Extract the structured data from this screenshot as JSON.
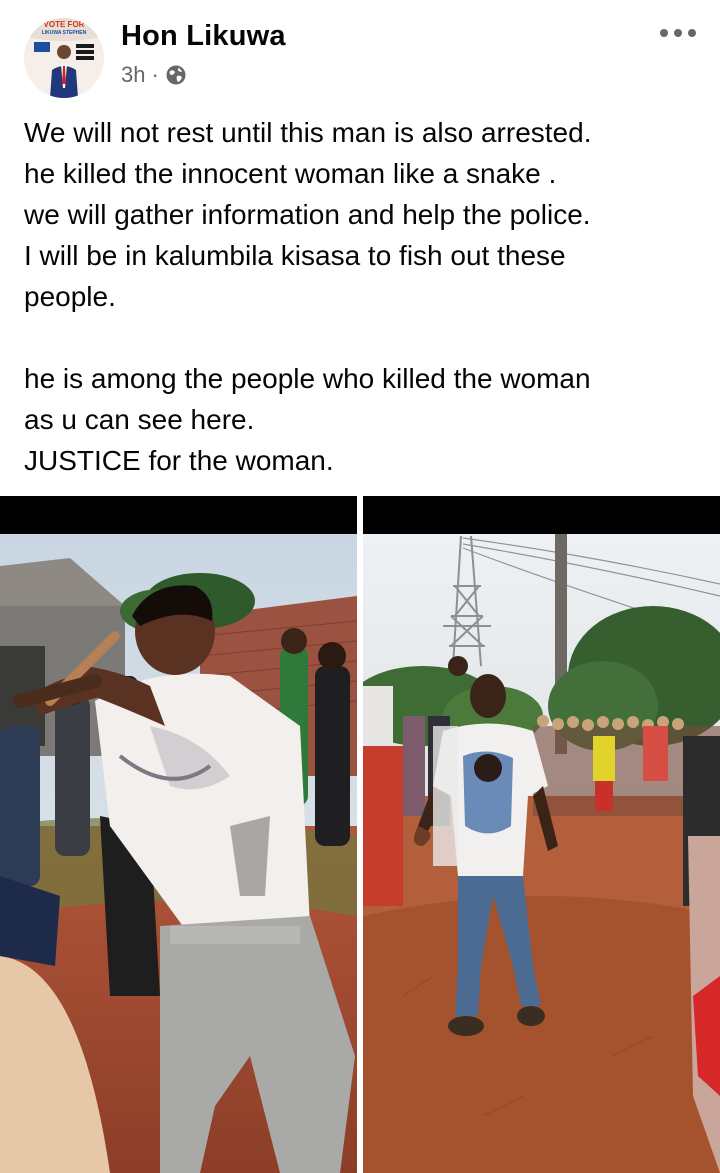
{
  "post": {
    "author": "Hon Likuwa",
    "time": "3h",
    "separator": "·",
    "privacy_icon": "globe-icon",
    "more_icon": "more-options-icon",
    "avatar_text": {
      "top": "VOTE FOR",
      "name": "LIKUWA STEPHEN"
    },
    "paragraphs": [
      [
        "We will not rest until this man is also arrested.",
        "he killed the innocent woman like a snake .",
        "we will gather information and help the police.",
        "I will be in kalumbila kisasa to fish out these",
        "people."
      ],
      [
        "he is among the people who killed the woman",
        "as u can see here.",
        "JUSTICE for the woman."
      ]
    ],
    "photos": [
      {
        "description_icon": "photo-left"
      },
      {
        "description_icon": "photo-right"
      }
    ]
  },
  "colors": {
    "text": "#050505",
    "secondary": "#65676b",
    "background": "#ffffff"
  }
}
